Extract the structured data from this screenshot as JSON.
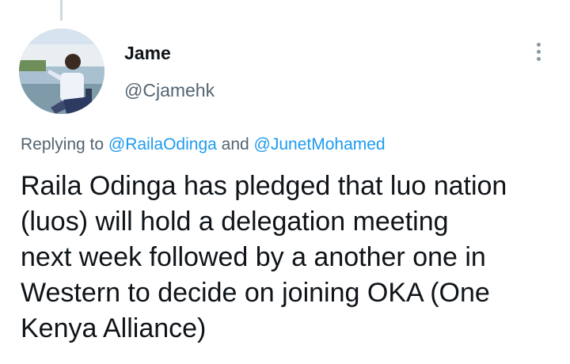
{
  "tweet": {
    "author": {
      "display_name": "Jame",
      "handle": "@Cjamehk",
      "avatar_icon": "profile-photo"
    },
    "more_icon": "more-vertical-icon",
    "replying": {
      "prefix": "Replying to",
      "mention_1": "@RailaOdinga",
      "conjunction": "and",
      "mention_2": "@JunetMohamed"
    },
    "text": "Raila Odinga has pledged that luo nation\n(luos) will hold a delegation meeting\nnext week followed by a another one in\nWestern to decide on joining OKA (One\nKenya Alliance)"
  },
  "colors": {
    "link": "#1d9bf0",
    "secondary_text": "#536471",
    "primary_text": "#0f1419",
    "thread_line": "#cfd9de"
  }
}
